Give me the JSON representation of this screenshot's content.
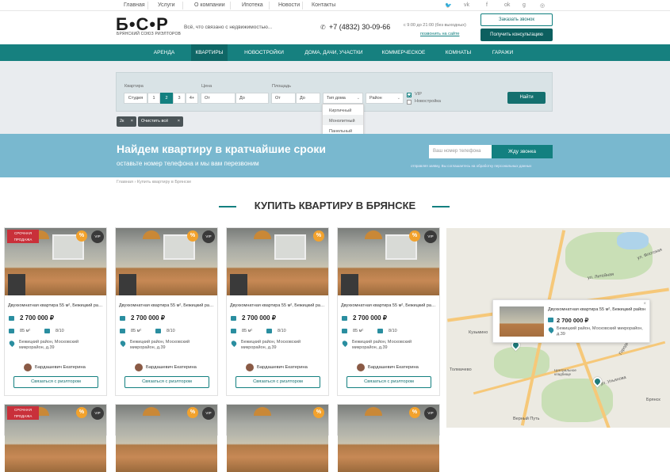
{
  "top_links": [
    "Главная",
    "Услуги",
    "О компании",
    "Ипотека",
    "Новости",
    "Контакты"
  ],
  "social_icons": [
    "twitter-icon",
    "vk-icon",
    "facebook-icon",
    "odnoklassniki-icon",
    "google-plus-icon",
    "instagram-icon"
  ],
  "header": {
    "logo_letters": "Б•С•Р",
    "logo_sub": "БРЯНСКИЙ СОЮЗ РИЭЛТОРОВ",
    "tagline": "Всё, что связано с недвижимостью...",
    "phone": "+7 (4832) 30-09-66",
    "hours": "с 9:00 до 21:00 (без выходных)",
    "call_link": "позвонить на сайте",
    "btn_order_call": "Заказать звонок",
    "btn_consult": "Получить консультацию"
  },
  "nav": [
    "Аренда",
    "Квартиры",
    "Новостройки",
    "Дома, дачи, участки",
    "Коммерческое",
    "Комнаты",
    "Гаражи"
  ],
  "filter": {
    "rooms_label": "Квартира",
    "rooms_options": [
      "Студия",
      "1",
      "2",
      "3",
      "4+"
    ],
    "rooms_selected": "2",
    "price_label": "Цена",
    "price_from": "От",
    "price_to": "До",
    "area_label": "Площадь",
    "area_from": "От",
    "area_to": "До",
    "house_type": "Тип дома",
    "district": "Район",
    "vip": "VIP",
    "newbuild": "Новостройка",
    "find_button": "Найти",
    "house_type_options": [
      "Кирпичный",
      "Монолитный",
      "Панельный"
    ],
    "chip_rooms": "2к",
    "chip_clear": "Очистить всё"
  },
  "banner": {
    "title": "Найдем квартиру в кратчайшие сроки",
    "subtitle": "оставьте номер телефона и мы вам перезвоним",
    "phone_placeholder": "Ваш номер телефона",
    "button": "Жду звонка",
    "note": "отправляя заявку, Вы соглашаетесь на обработку персональных данных"
  },
  "breadcrumb": "Главная  ›  Купить квартиру в Брянске",
  "section_title": "КУПИТЬ КВАРТИРУ В БРЯНСКЕ",
  "cards": [
    {
      "sale_badge": "СРОЧНАЯ ПРОДАЖА",
      "vip": "VIP",
      "title": "Двухкомнатная квартира 55 м², Бежицкий район",
      "price": "2 700 000 ₽",
      "area": "85 м²",
      "floor": "8/10",
      "address": "Бежицкий район, Московский микрорайон, д.39",
      "agent": "Бардашевич Екатерина",
      "contact": "Связаться с риэлтором"
    },
    {
      "sale_badge": "",
      "vip": "VIP",
      "title": "Двухкомнатная квартира 55 м², Бежицкий район",
      "price": "2 700 000 ₽",
      "area": "85 м²",
      "floor": "8/10",
      "address": "Бежицкий район, Московский микрорайон, д.39",
      "agent": "Бардашевич Екатерина",
      "contact": "Связаться с риэлтором"
    },
    {
      "sale_badge": "",
      "vip": "",
      "title": "Двухкомнатная квартира 55 м², Бежицкий район",
      "price": "2 700 000 ₽",
      "area": "85 м²",
      "floor": "8/10",
      "address": "Бежицкий район, Московский микрорайон, д.39",
      "agent": "Бардашевич Екатерина",
      "contact": "Связаться с риэлтором"
    },
    {
      "sale_badge": "",
      "vip": "VIP",
      "title": "Двухкомнатная квартира 55 м², Бежицкий район",
      "price": "2 700 000 ₽",
      "area": "85 м²",
      "floor": "8/10",
      "address": "Бежицкий район, Московский микрорайон, д.39",
      "agent": "Бардашевич Екатерина",
      "contact": "Связаться с риэлтором"
    }
  ],
  "percent_badge": "%",
  "map": {
    "labels": [
      "Кузьмино",
      "Толмачево",
      "Брянск",
      "Верный Путь",
      "ул. Литейная",
      "ул. Флотская",
      "Городецкая ул.",
      "ул. Ульянова",
      "Центральное кладбище"
    ],
    "popup": {
      "title": "Двухкомнатная квартира 55 м², Бежицкий район",
      "price": "2 700 000 ₽",
      "address": "Бежицкий район, Московский микрорайон, д.39"
    }
  }
}
